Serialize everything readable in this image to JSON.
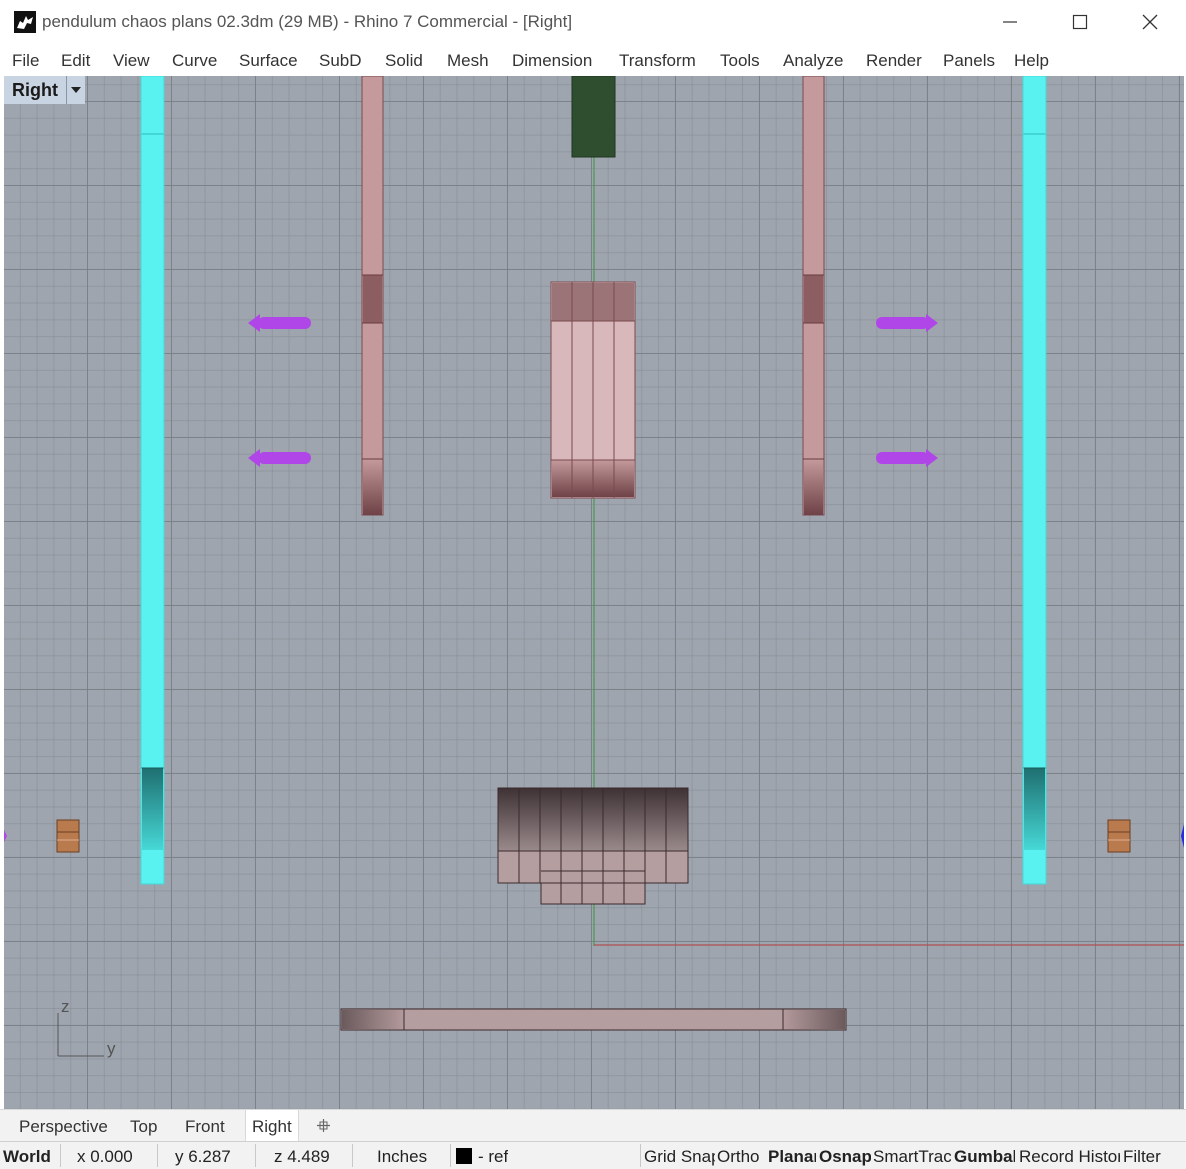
{
  "window": {
    "title": "pendulum chaos plans 02.3dm (29 MB) - Rhino 7 Commercial - [Right]",
    "minimize_icon": "minimize-icon",
    "maximize_icon": "maximize-icon",
    "close_icon": "close-icon"
  },
  "menu": [
    "File",
    "Edit",
    "View",
    "Curve",
    "Surface",
    "SubD",
    "Solid",
    "Mesh",
    "Dimension",
    "Transform",
    "Tools",
    "Analyze",
    "Render",
    "Panels",
    "Help"
  ],
  "viewport": {
    "label": "Right",
    "axis_z": "z",
    "axis_y": "y"
  },
  "tabs": [
    "Perspective",
    "Top",
    "Front",
    "Right"
  ],
  "add_tab_icon": "add-viewport-tab-icon",
  "status": {
    "cplane": "World",
    "x": "x 0.000",
    "y": "y 6.287",
    "z": "z 4.489",
    "units": "Inches",
    "layer": "- ref",
    "toggles": [
      "Grid Snap",
      "Ortho",
      "Planar",
      "Osnap",
      "SmartTrack",
      "Gumball",
      "Record History",
      "Filter"
    ]
  },
  "colors": {
    "grid_bg": "#9ea5ae",
    "cyan_rail": "#59f2f0",
    "pink_part": "#c49a9c",
    "purple_arrow": "#b046e8",
    "green_axis": "#4c9a4c",
    "red_axis": "#b05050"
  }
}
